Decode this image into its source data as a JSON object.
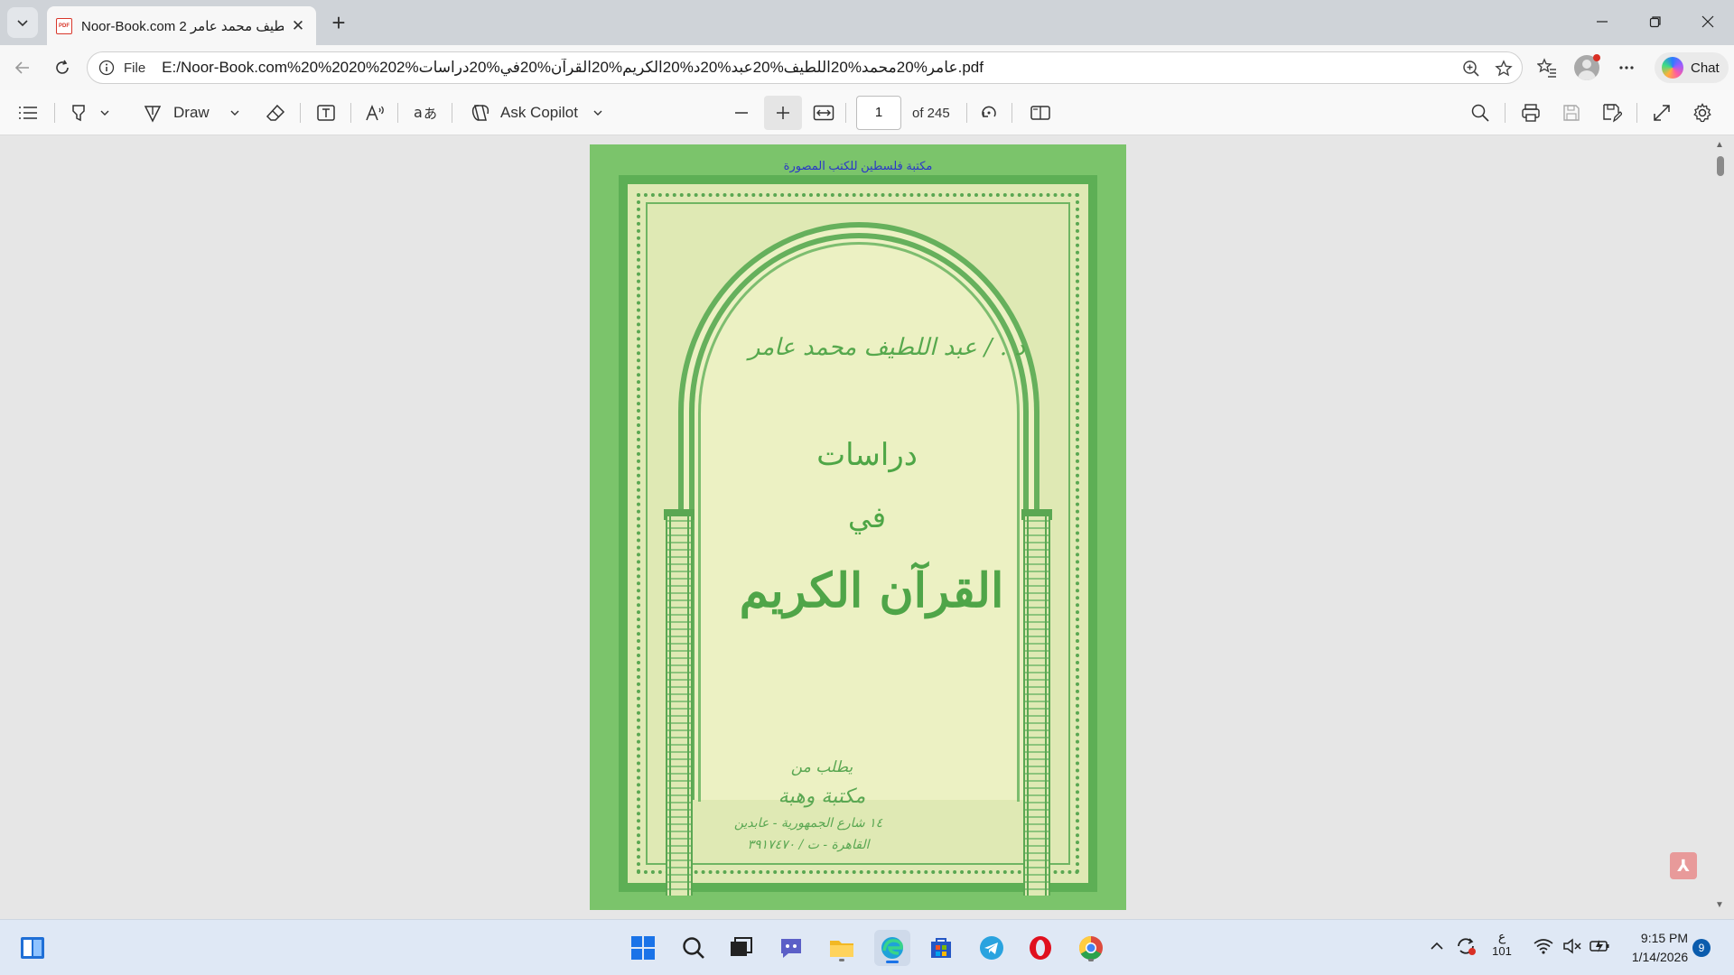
{
  "browser": {
    "tab": {
      "title": "Noor-Book.com  لطيف محمد عامر 2"
    },
    "address": {
      "scheme_label": "File",
      "url": "E:/Noor-Book.com%20%2020%202%عامر%20محمد%20اللطيف%20عبد%20د%20الكريم%20القرآن%20في%20دراسات.pdf"
    },
    "chat_label": "Chat"
  },
  "pdf_toolbar": {
    "draw_label": "Draw",
    "ask_copilot_label": "Ask Copilot",
    "page_current": "1",
    "page_total": "of 245"
  },
  "cover": {
    "watermark": "مكتبة فلسطين للكتب المصورة",
    "author": "د . / عبد اللطيف محمد عامر",
    "title_line1": "دراسات",
    "title_line2": "في",
    "title_line3": "القرآن الكريم",
    "publisher_intro": "يطلب من",
    "publisher_name": "مكتبة وهبة",
    "publisher_address": "١٤ شارع الجمهورية - عابدين",
    "publisher_phone": "القاهرة - ت / ٣٩١٧٤٧٠"
  },
  "taskbar": {
    "keyboard_lang": "ع",
    "keyboard_code": "101",
    "time": "9:15 PM",
    "date": "1/14/2026",
    "notification_count": "9"
  },
  "colors": {
    "cover_green": "#7bc46b",
    "cover_cream": "#dfe9b4",
    "ornament_green": "#4ea646",
    "watermark_blue": "#2a36c9"
  }
}
